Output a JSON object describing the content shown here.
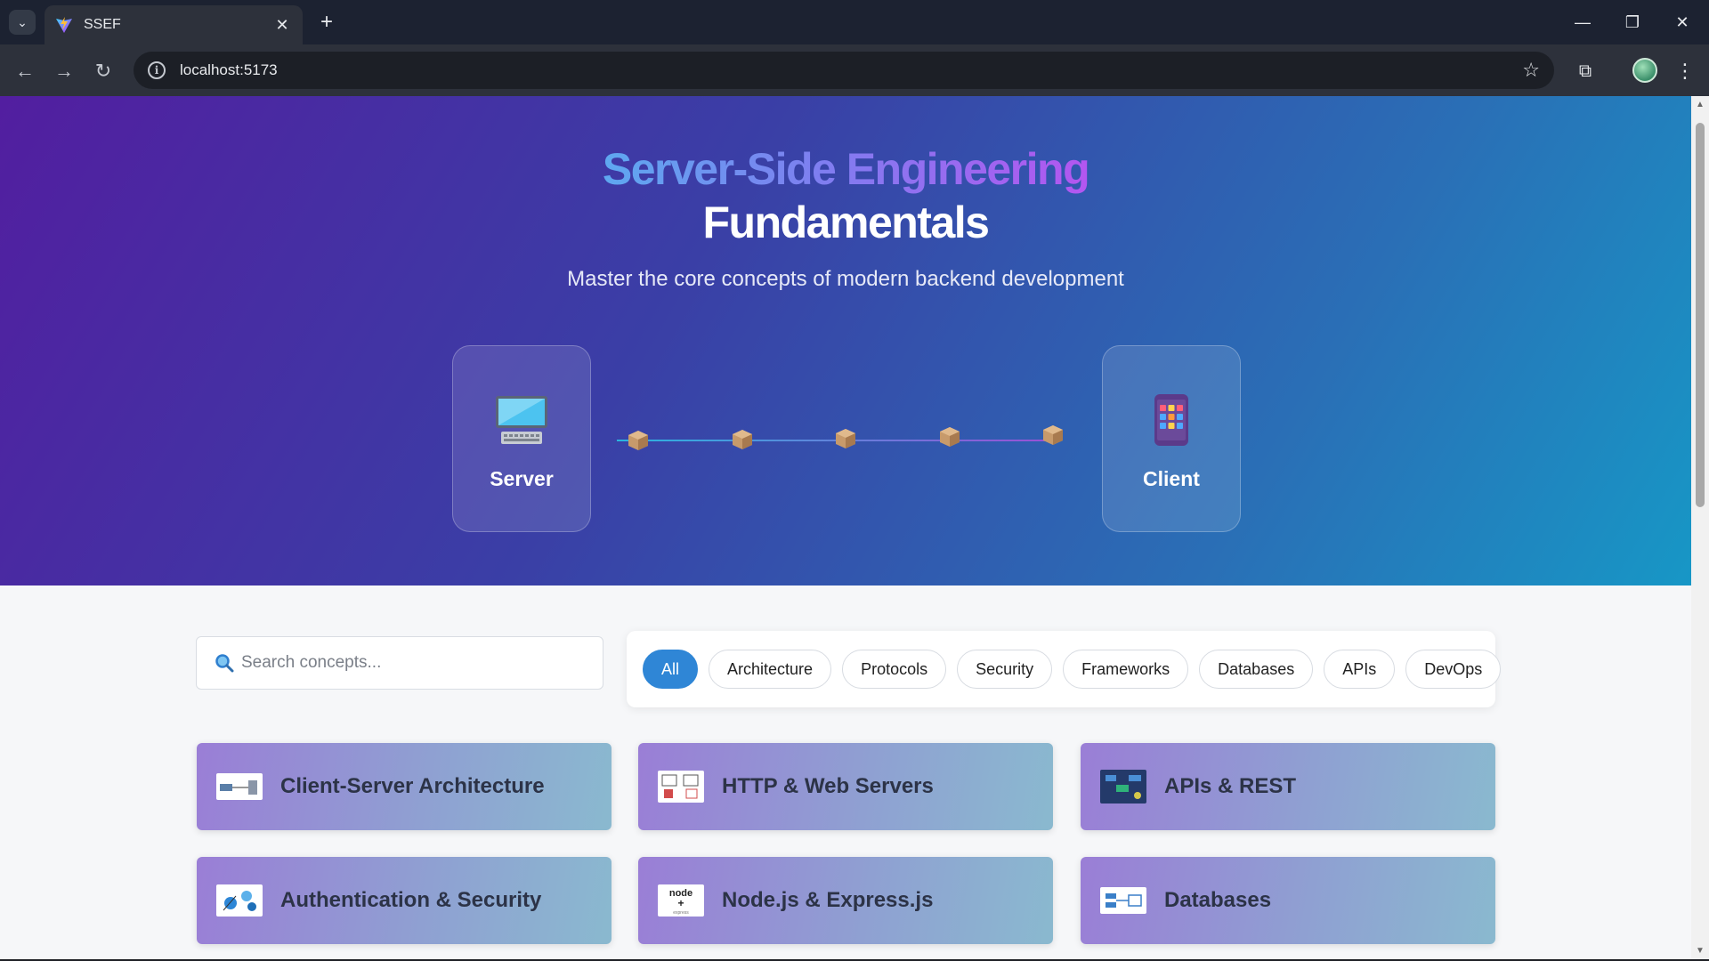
{
  "browser": {
    "tab_title": "SSEF",
    "url": "localhost:5173"
  },
  "hero": {
    "title_line1": "Server-Side Engineering",
    "title_line2": "Fundamentals",
    "subtitle": "Master the core concepts of modern backend development",
    "server_label": "Server",
    "client_label": "Client"
  },
  "search": {
    "placeholder": "Search concepts..."
  },
  "filters": [
    {
      "label": "All",
      "active": true
    },
    {
      "label": "Architecture",
      "active": false
    },
    {
      "label": "Protocols",
      "active": false
    },
    {
      "label": "Security",
      "active": false
    },
    {
      "label": "Frameworks",
      "active": false
    },
    {
      "label": "Databases",
      "active": false
    },
    {
      "label": "APIs",
      "active": false
    },
    {
      "label": "DevOps",
      "active": false
    }
  ],
  "cards": [
    {
      "title": "Client-Server Architecture",
      "thumb": "client-server-diagram"
    },
    {
      "title": "HTTP & Web Servers",
      "thumb": "http-diagram"
    },
    {
      "title": "APIs & REST",
      "thumb": "api-diagram"
    },
    {
      "title": "Authentication & Security",
      "thumb": "security-diagram"
    },
    {
      "title": "Node.js & Express.js",
      "thumb": "node-express-logo"
    },
    {
      "title": "Databases",
      "thumb": "database-diagram"
    }
  ],
  "colors": {
    "accent": "#2f86d6",
    "hero_start": "#521ea0",
    "hero_end": "#1797c6"
  }
}
